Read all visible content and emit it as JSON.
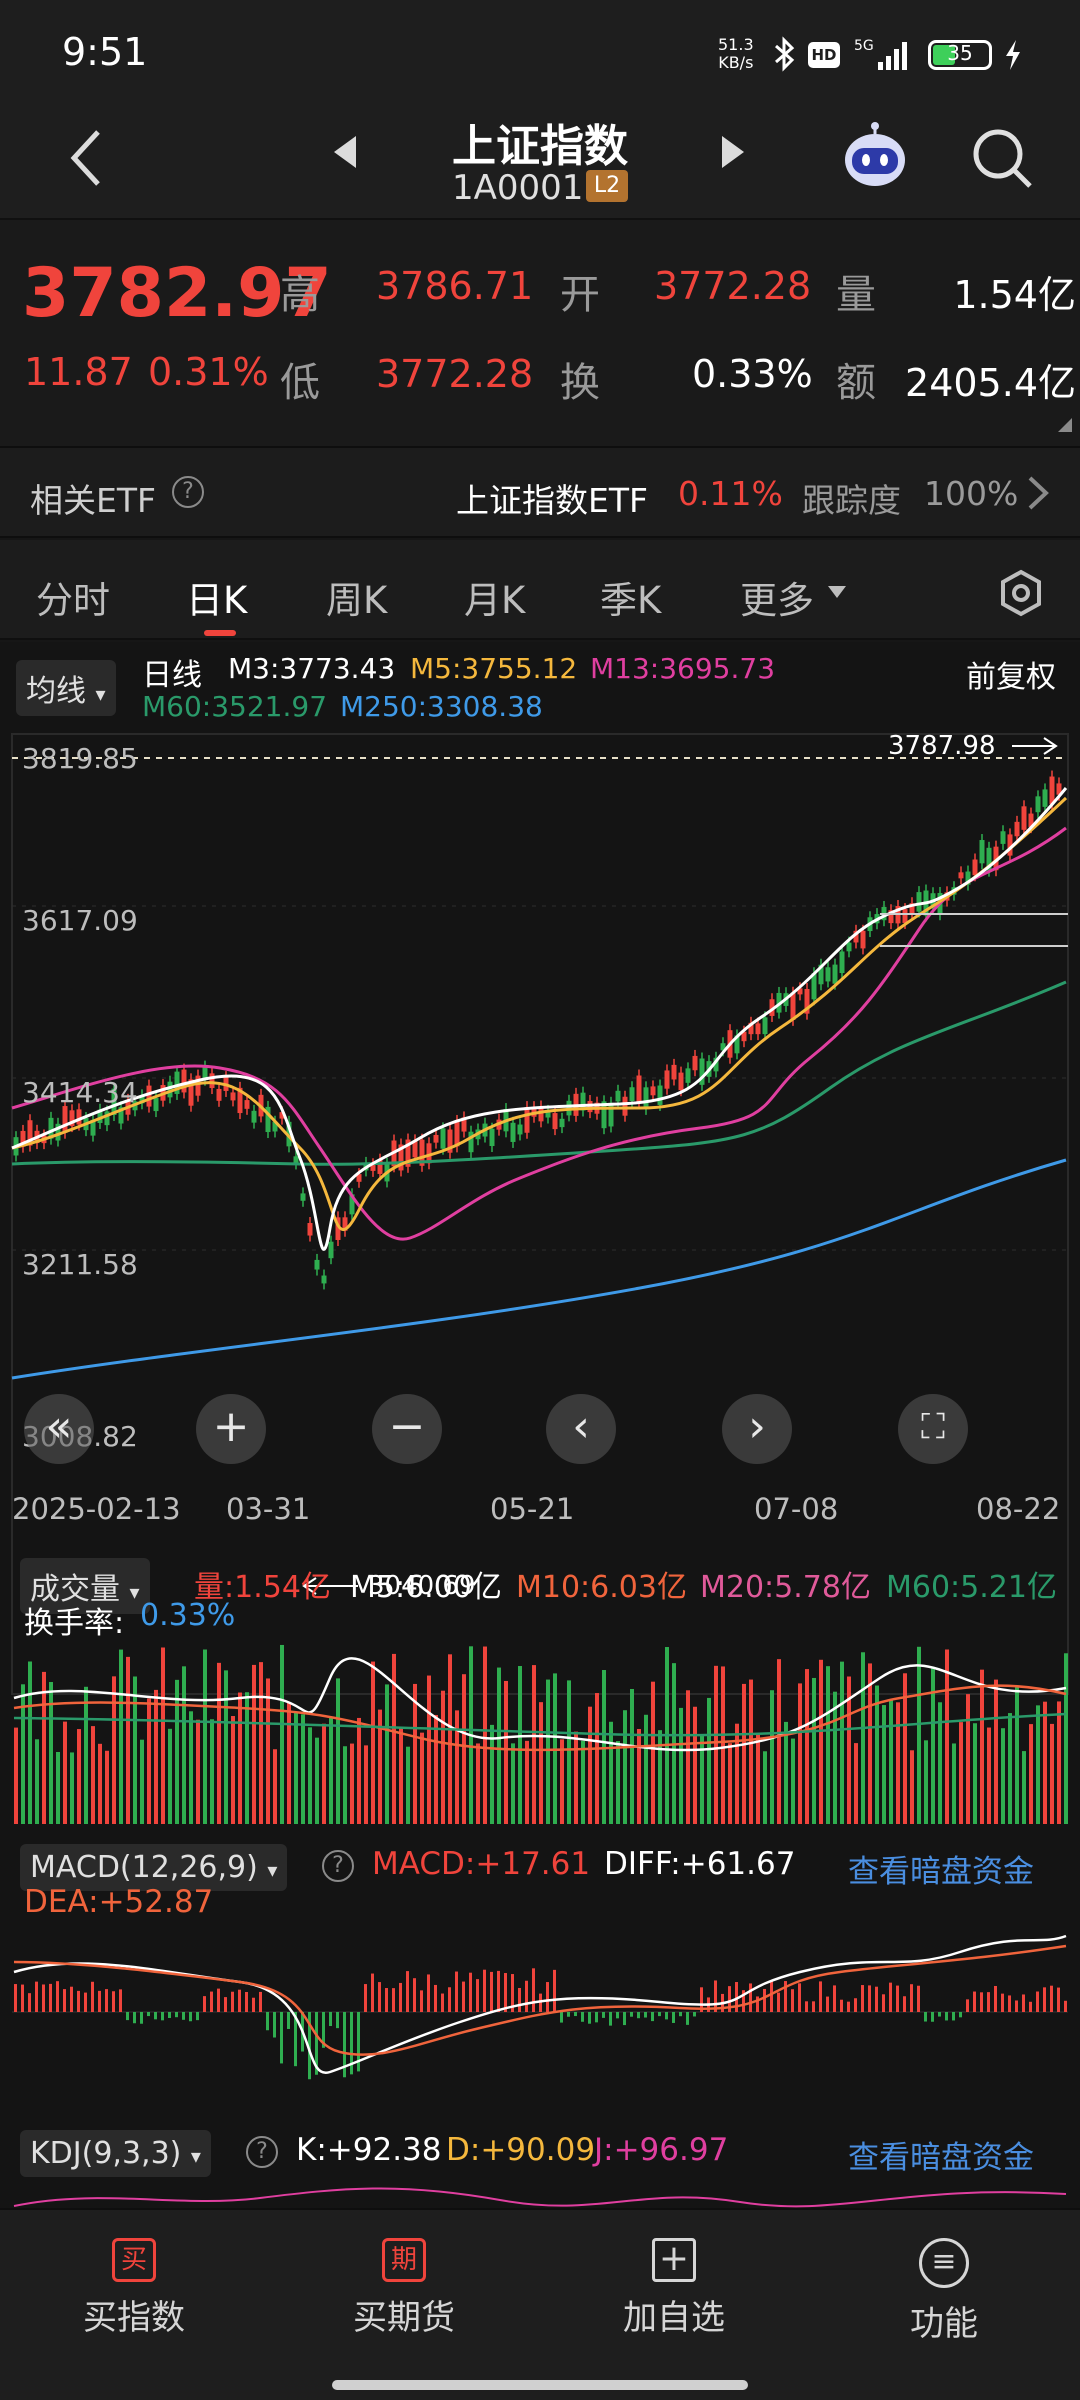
{
  "status_bar": {
    "time": "9:51",
    "net_speed": "51.3\nKB/s",
    "battery": "35"
  },
  "header": {
    "title": "上证指数",
    "code": "1A0001",
    "level_badge": "L2"
  },
  "quote": {
    "price": "3782.97",
    "change": "11.87",
    "change_pct": "0.31%",
    "high_label": "高",
    "high": "3786.71",
    "low_label": "低",
    "low": "3772.28",
    "open_label": "开",
    "open": "3772.28",
    "turnover_label": "换",
    "turnover": "0.33%",
    "volume_label": "量",
    "volume": "1.54亿",
    "amount_label": "额",
    "amount": "2405.4亿"
  },
  "etf": {
    "label": "相关ETF",
    "name": "上证指数ETF",
    "change": "0.11%",
    "tracking_label": "跟踪度",
    "tracking": "100%"
  },
  "tabs": [
    "分时",
    "日K",
    "周K",
    "月K",
    "季K",
    "更多"
  ],
  "kline": {
    "ma_dropdown": "均线",
    "period_label": "日线",
    "adjust": "前复权",
    "ma3": "M3:3773.43",
    "ma5": "M5:3755.12",
    "ma13": "M13:3695.73",
    "ma60": "M60:3521.97",
    "ma250": "M250:3308.38",
    "price_ticks": [
      "3819.85",
      "3617.09",
      "3414.34",
      "3211.58",
      "3008.82"
    ],
    "high_marker": "3787.98",
    "low_marker": "3040.69",
    "dates": [
      "2025-02-13",
      "03-31",
      "05-21",
      "07-08",
      "08-22"
    ]
  },
  "volume_panel": {
    "dropdown": "成交量",
    "vol": "量:1.54亿",
    "m5": "M5:6.00亿",
    "m10": "M10:6.03亿",
    "m20": "M20:5.78亿",
    "m60": "M60:5.21亿",
    "turnover_label": "换手率:",
    "turnover_value": "0.33%"
  },
  "macd_panel": {
    "dropdown": "MACD(12,26,9)",
    "macd": "MACD:+17.61",
    "diff": "DIFF:+61.67",
    "dea": "DEA:+52.87",
    "link": "查看暗盘资金"
  },
  "kdj_panel": {
    "dropdown": "KDJ(9,3,3)",
    "k": "K:+92.38",
    "d": "D:+90.09",
    "j": "J:+96.97",
    "link": "查看暗盘资金"
  },
  "bottom_nav": [
    {
      "label": "买指数",
      "icon": "买"
    },
    {
      "label": "买期货",
      "icon": "期"
    },
    {
      "label": "加自选",
      "icon": "+"
    },
    {
      "label": "功能",
      "icon": "≡"
    }
  ],
  "colors": {
    "up": "#f0443c",
    "down": "#2fae50",
    "ma3": "#ffffff",
    "ma5": "#f5b83d",
    "ma13": "#e03fa0",
    "ma60": "#2a9a6a",
    "ma250": "#3f9ae8",
    "link": "#4a8ee0"
  },
  "chart_data": [
    {
      "type": "line",
      "title": "日线",
      "ylim": [
        3008.82,
        3819.85
      ],
      "x": [
        "2025-02-13",
        "03-31",
        "05-21",
        "07-08",
        "08-22"
      ],
      "series": [
        {
          "name": "M60",
          "values": [
            3330,
            3340,
            3365,
            3390,
            3521.97
          ]
        },
        {
          "name": "M250",
          "values": [
            3050,
            3120,
            3180,
            3230,
            3308.38
          ]
        }
      ]
    }
  ]
}
